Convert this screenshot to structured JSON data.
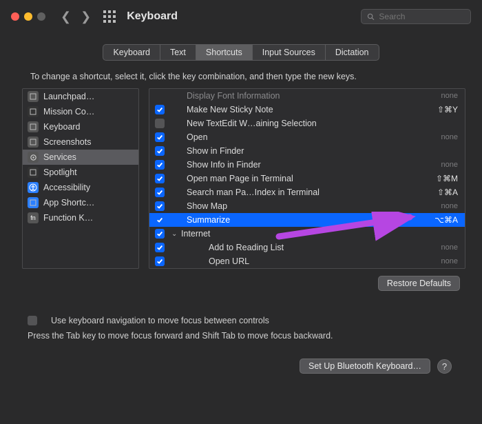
{
  "window": {
    "title": "Keyboard",
    "search_placeholder": "Search"
  },
  "tabs": [
    {
      "label": "Keyboard",
      "active": false
    },
    {
      "label": "Text",
      "active": false
    },
    {
      "label": "Shortcuts",
      "active": true
    },
    {
      "label": "Input Sources",
      "active": false
    },
    {
      "label": "Dictation",
      "active": false
    }
  ],
  "instruction": "To change a shortcut, select it, click the key combination, and then type the new keys.",
  "categories": [
    {
      "label": "Launchpad…",
      "icon_bg": "#555",
      "icon": "rocket"
    },
    {
      "label": "Mission Co…",
      "icon_bg": "#333",
      "icon": "mission"
    },
    {
      "label": "Keyboard",
      "icon_bg": "#555",
      "icon": "keyboard"
    },
    {
      "label": "Screenshots",
      "icon_bg": "#555",
      "icon": "screenshot"
    },
    {
      "label": "Services",
      "icon_bg": "#555",
      "icon": "gear",
      "selected": true
    },
    {
      "label": "Spotlight",
      "icon_bg": "#333",
      "icon": "spotlight"
    },
    {
      "label": "Accessibility",
      "icon_bg": "#2a7fff",
      "icon": "accessibility"
    },
    {
      "label": "App Shortc…",
      "icon_bg": "#2a7fff",
      "icon": "appshortcut"
    },
    {
      "label": "Function K…",
      "icon_bg": "#555",
      "icon": "fn"
    }
  ],
  "shortcuts": [
    {
      "checked": null,
      "label": "Display Font Information",
      "shortcut": "none",
      "faded": true
    },
    {
      "checked": true,
      "label": "Make New Sticky Note",
      "shortcut": "⇧⌘Y"
    },
    {
      "checked": false,
      "label": "New TextEdit W…aining Selection",
      "shortcut": ""
    },
    {
      "checked": true,
      "label": "Open",
      "shortcut": "none"
    },
    {
      "checked": true,
      "label": "Show in Finder",
      "shortcut": ""
    },
    {
      "checked": true,
      "label": "Show Info in Finder",
      "shortcut": "none"
    },
    {
      "checked": true,
      "label": "Open man Page in Terminal",
      "shortcut": "⇧⌘M"
    },
    {
      "checked": true,
      "label": "Search man Pa…Index in Terminal",
      "shortcut": "⇧⌘A"
    },
    {
      "checked": true,
      "label": "Show Map",
      "shortcut": "none"
    },
    {
      "checked": true,
      "label": "Summarize",
      "shortcut": "⌥⌘A",
      "selected": true
    },
    {
      "checked": true,
      "label": "Internet",
      "group": true
    },
    {
      "checked": true,
      "label": "Add to Reading List",
      "shortcut": "none",
      "indent": true
    },
    {
      "checked": true,
      "label": "Open URL",
      "shortcut": "none",
      "indent": true
    }
  ],
  "buttons": {
    "restore_defaults": "Restore Defaults",
    "setup_bluetooth": "Set Up Bluetooth Keyboard…"
  },
  "kb_nav": {
    "checkbox_checked": false,
    "label": "Use keyboard navigation to move focus between controls",
    "hint": "Press the Tab key to move focus forward and Shift Tab to move focus backward."
  }
}
